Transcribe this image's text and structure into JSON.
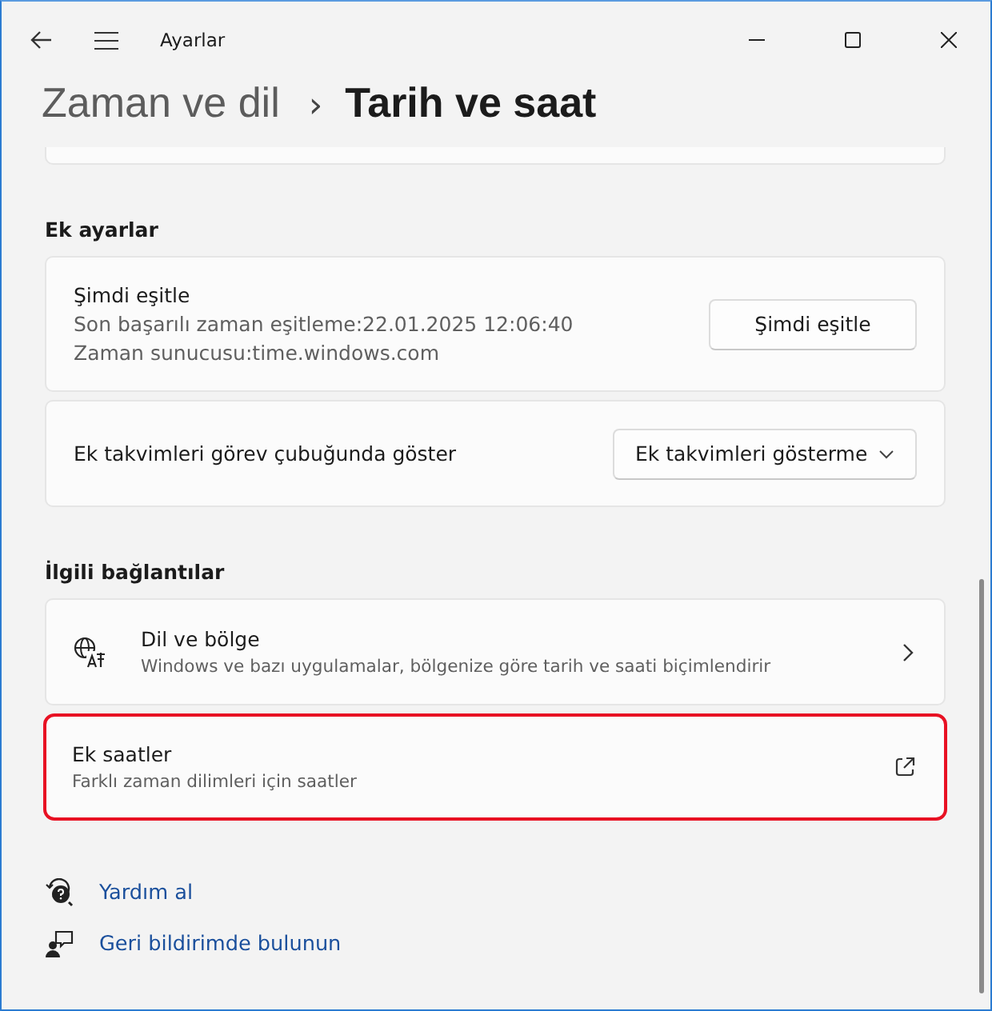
{
  "window": {
    "title": "Ayarlar"
  },
  "breadcrumb": {
    "parent": "Zaman ve dil",
    "separator": "›",
    "current": "Tarih ve saat"
  },
  "sections": [
    {
      "title": "Ek ayarlar",
      "cards": [
        {
          "kind": "button",
          "title": "Şimdi eşitle",
          "lines": [
            "Son başarılı zaman eşitleme:22.01.2025 12:06:40",
            "Zaman sunucusu:time.windows.com"
          ],
          "control": "Şimdi eşitle"
        },
        {
          "kind": "dropdown",
          "title": "Ek takvimleri görev çubuğunda göster",
          "control": "Ek takvimleri gösterme"
        }
      ]
    },
    {
      "title": "İlgili bağlantılar",
      "cards": [
        {
          "kind": "chevron",
          "title": "Dil ve bölge",
          "lines": [
            "Windows ve bazı uygulamalar, bölgenize göre tarih ve saati biçimlendirir"
          ],
          "highlighted": false
        },
        {
          "kind": "external",
          "title": "Ek saatler",
          "lines": [
            "Farklı zaman dilimleri için saatler"
          ],
          "highlighted": true
        }
      ]
    }
  ],
  "help_links": [
    {
      "kind": "help",
      "label": "Yardım al"
    },
    {
      "kind": "feedback",
      "label": "Geri bildirimde bulunun"
    }
  ]
}
